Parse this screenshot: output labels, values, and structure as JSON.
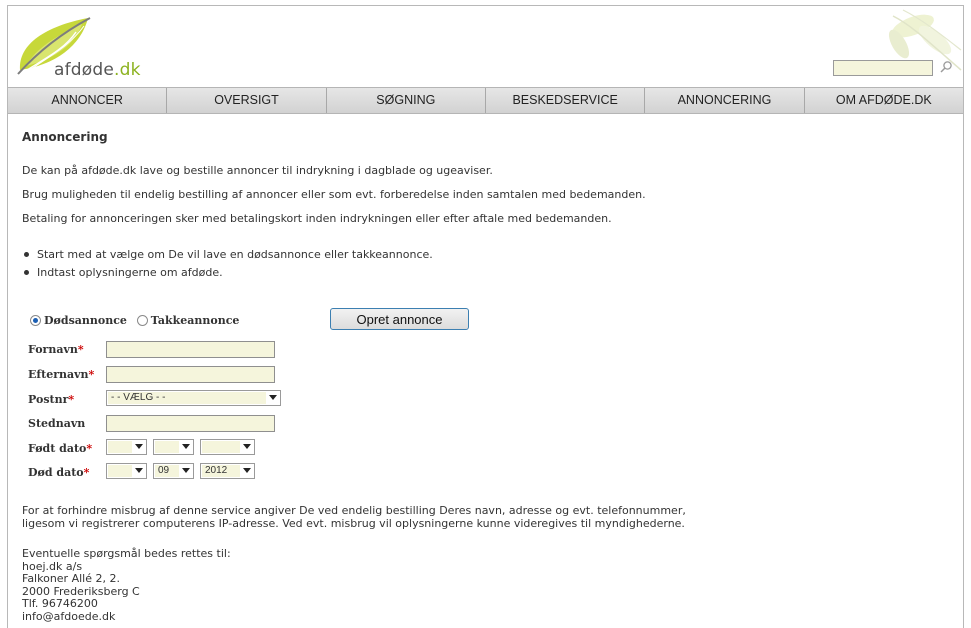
{
  "brand": {
    "name": "afdøde",
    "tld": ".dk"
  },
  "search": {
    "placeholder": ""
  },
  "nav": {
    "items": [
      "ANNONCER",
      "OVERSIGT",
      "SØGNING",
      "BESKEDSERVICE",
      "ANNONCERING",
      "OM AFDØDE.DK"
    ]
  },
  "page": {
    "title": "Annoncering",
    "paragraphs": [
      "De kan på afdøde.dk lave og bestille annoncer til indrykning i dagblade og ugeaviser.",
      "Brug muligheden til endelig bestilling af annoncer eller som evt. forberedelse inden samtalen med bedemanden.",
      "Betaling for annonceringen sker med betalingskort inden indrykningen eller efter aftale med bedemanden."
    ],
    "bullets": [
      "Start med at vælge om De vil lave en dødsannonce eller takkeannonce.",
      "Indtast oplysningerne om afdøde."
    ]
  },
  "form": {
    "radio_dods": "Dødsannonce",
    "radio_takke": "Takkeannonce",
    "selected": "Dødsannonce",
    "submit_label": "Opret annonce",
    "required_mark": "*",
    "labels": {
      "fornavn": "Fornavn",
      "efternavn": "Efternavn",
      "postnr": "Postnr",
      "stednavn": "Stednavn",
      "fodt": "Født dato",
      "dod": "Død dato"
    },
    "values": {
      "fornavn": "",
      "efternavn": "",
      "stednavn": "",
      "postnr": "- - VÆLG - -",
      "fodt_day": "",
      "fodt_month": "",
      "fodt_year": "",
      "dod_day": "",
      "dod_month": "09",
      "dod_year": "2012"
    }
  },
  "footer": {
    "notice": [
      "For at forhindre misbrug af denne service angiver De ved endelig bestilling Deres navn, adresse og evt. telefonnummer,",
      "ligesom vi registrerer computerens IP-adresse. Ved evt. misbrug vil oplysningerne kunne videregives til myndighederne."
    ],
    "contact": [
      "Eventuelle spørgsmål bedes rettes til:",
      "hoej.dk a/s",
      "Falkoner Allé 2, 2.",
      "2000 Frederiksberg C",
      "Tlf. 96746200",
      "info@afdoede.dk"
    ]
  },
  "colors": {
    "accent_green": "#8cb21f",
    "input_bg": "#f5f5dc",
    "nav_bg": "#dcdcdc",
    "required": "#cc0000",
    "radio_blue": "#1c5fb3"
  }
}
